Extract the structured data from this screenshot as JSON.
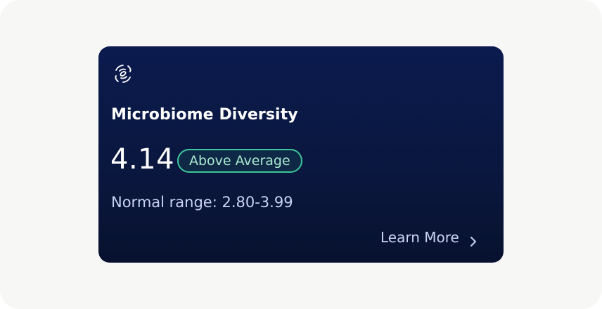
{
  "card": {
    "icon": "microbiome-icon",
    "title": "Microbiome Diversity",
    "value": "4.14",
    "badge": "Above Average",
    "range_text": "Normal range: 2.80-3.99",
    "link_label": "Learn More",
    "link_icon": "chevron-right-icon"
  },
  "colors": {
    "page_background": "#f7f7f6",
    "card_background": "#0a173f",
    "badge_border": "#3cc79a",
    "badge_text": "#a9e9cf",
    "secondary_text": "#c9d2f2"
  }
}
